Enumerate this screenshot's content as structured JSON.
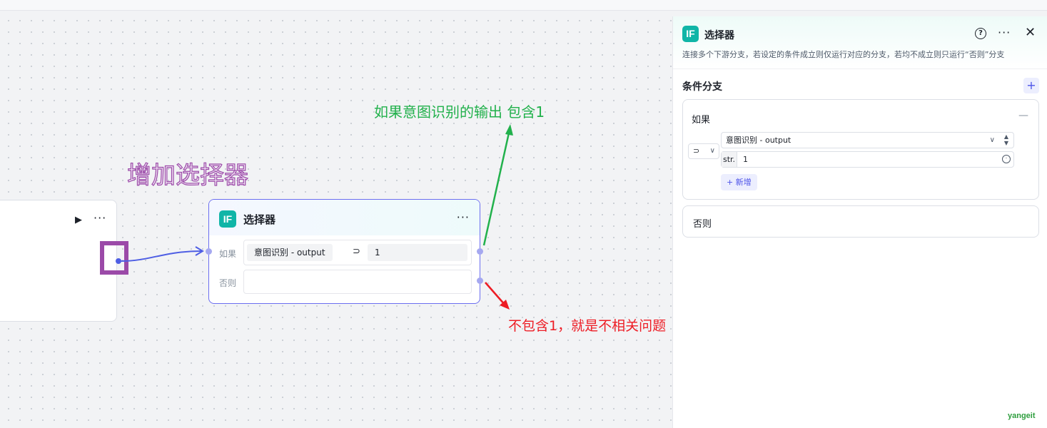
{
  "canvas": {
    "prev_node": {
      "run_icon": "play-icon",
      "more_icon": "more-icon"
    },
    "selector_node": {
      "icon_text": "IF",
      "title": "选择器",
      "if_label": "如果",
      "else_label": "否则",
      "condition": {
        "variable": "意图识别 - output",
        "operator": "⊃",
        "value": "1"
      }
    },
    "annotations": {
      "green": "如果意图识别的输出 包含1",
      "purple": "增加选择器",
      "red": "不包含1，就是不相关问题"
    },
    "colors": {
      "green": "#22b14c",
      "purple": "#9b4aa8",
      "red": "#ed1c24",
      "accent": "#4e5ee4",
      "if_icon": "#10b5a7"
    }
  },
  "panel": {
    "icon_text": "IF",
    "title": "选择器",
    "description": "连接多个下游分支，若设定的条件成立则仅运行对应的分支，若均不成立则只运行“否则”分支",
    "section_title": "条件分支",
    "add_label": "+",
    "if_card": {
      "title": "如果",
      "collapse": "—",
      "operator": "⊃",
      "operator_arrow": "∨",
      "variable": "意图识别 - output",
      "value_type": "str.",
      "value": "1",
      "new_button": "+ 新增"
    },
    "else_card": {
      "title": "否则"
    }
  },
  "watermark": "yangeit"
}
